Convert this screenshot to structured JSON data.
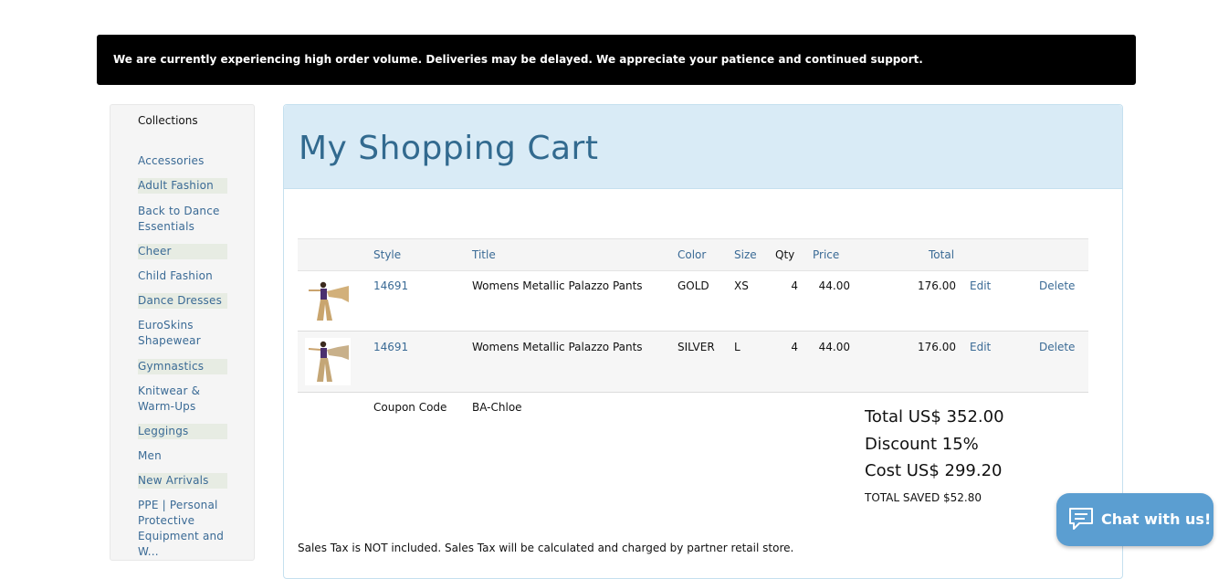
{
  "banner": {
    "text": "We are currently experiencing high order volume. Deliveries may be delayed. We appreciate your patience and continued support."
  },
  "sidebar": {
    "heading": "Collections",
    "items": [
      {
        "label": "Accessories"
      },
      {
        "label": "Adult Fashion"
      },
      {
        "label": "Back to Dance Essentials"
      },
      {
        "label": "Cheer"
      },
      {
        "label": "Child Fashion"
      },
      {
        "label": "Dance Dresses"
      },
      {
        "label": "EuroSkins Shapewear"
      },
      {
        "label": "Gymnastics"
      },
      {
        "label": "Knitwear & Warm-Ups"
      },
      {
        "label": "Leggings"
      },
      {
        "label": "Men"
      },
      {
        "label": "New Arrivals"
      },
      {
        "label": "PPE | Personal Protective Equipment and W..."
      }
    ]
  },
  "cart": {
    "title": "My Shopping Cart",
    "columns": {
      "style": "Style",
      "title": "Title",
      "color": "Color",
      "size": "Size",
      "qty": "Qty",
      "price": "Price",
      "total": "Total"
    },
    "rows": [
      {
        "style": "14691",
        "title": "Womens Metallic Palazzo Pants",
        "color": "GOLD",
        "size": "XS",
        "qty": "4",
        "price": "44.00",
        "total": "176.00",
        "edit": "Edit",
        "delete": "Delete"
      },
      {
        "style": "14691",
        "title": "Womens Metallic Palazzo Pants",
        "color": "SILVER",
        "size": "L",
        "qty": "4",
        "price": "44.00",
        "total": "176.00",
        "edit": "Edit",
        "delete": "Delete"
      }
    ],
    "coupon_label": "Coupon Code",
    "coupon_value": "BA-Chloe",
    "total_line": "Total US$ 352.00",
    "discount_line": "Discount 15%",
    "cost_line": "Cost US$ 299.20",
    "saved_line": "TOTAL SAVED $52.80",
    "tax_note": "Sales Tax is NOT included. Sales Tax will be calculated and charged by partner retail store."
  },
  "chat": {
    "label": "Chat with us!"
  },
  "colors": {
    "link": "#3a6a95",
    "header_bg": "#d9ebf6",
    "chat_bg": "#5b9ed1",
    "banner_bg": "#000000"
  },
  "icons": [
    "chat-bubble-icon",
    "product-thumbnail"
  ]
}
